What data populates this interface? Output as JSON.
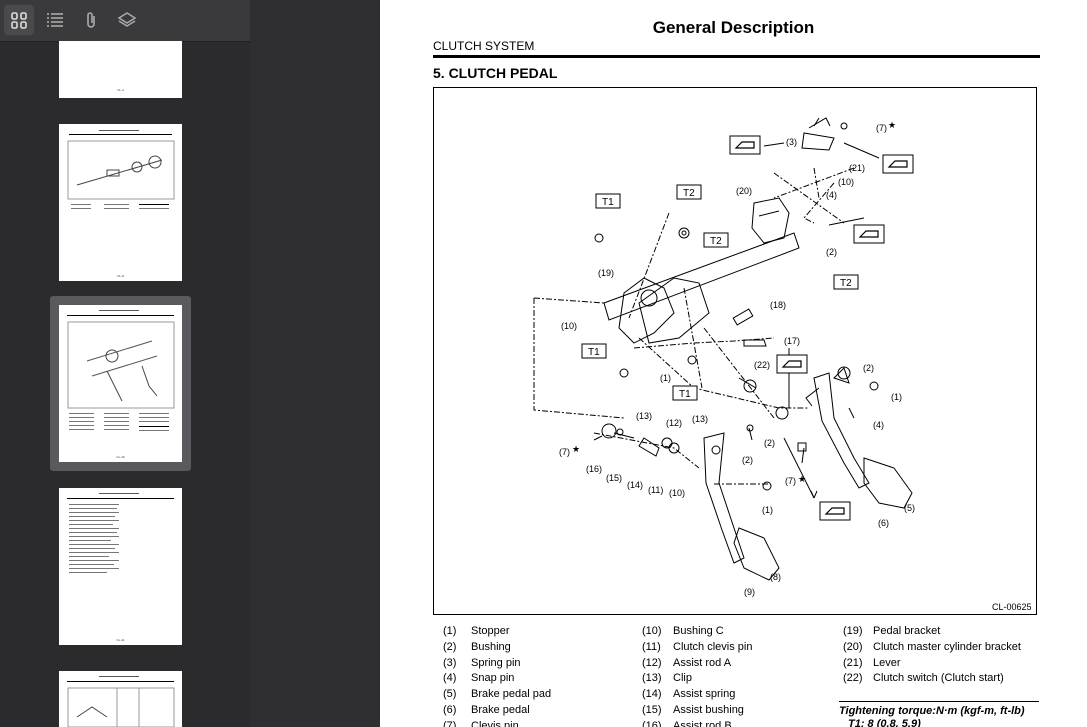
{
  "sidebar": {
    "toolbar": [
      {
        "name": "thumbnails-view",
        "icon": "grid-icon"
      },
      {
        "name": "outline-view",
        "icon": "list-icon"
      },
      {
        "name": "attachments-view",
        "icon": "paperclip-icon"
      },
      {
        "name": "layers-view",
        "icon": "layers-icon"
      }
    ],
    "thumbnails": [
      {
        "page_label": "CL-4"
      },
      {
        "page_label": "CL-8"
      },
      {
        "page_label": "CL-10"
      },
      {
        "page_label": "CL-11"
      },
      {
        "page_label": ""
      }
    ]
  },
  "document": {
    "title": "General Description",
    "section": "CLUTCH SYSTEM",
    "heading": "5.  CLUTCH PEDAL",
    "figure_code": "CL-00625",
    "labels": {
      "T1": "T1",
      "T2": "T2",
      "n1": "(1)",
      "n2": "(2)",
      "n3": "(3)",
      "n4": "(4)",
      "n6": "(6)",
      "n5": "(5)",
      "n7": "(7)",
      "n8": "(8)",
      "n9": "(9)",
      "n10": "(10)",
      "n11": "(11)",
      "n12": "(12)",
      "n13": "(13)",
      "n14": "(14)",
      "n15": "(15)",
      "n16": "(16)",
      "n17": "(17)",
      "n18": "(18)",
      "n19": "(19)",
      "n20": "(20)",
      "n21": "(21)",
      "n22": "(22)",
      "star": "★"
    },
    "legend": [
      [
        {
          "num": "(1)",
          "text": "Stopper"
        },
        {
          "num": "(2)",
          "text": "Bushing"
        },
        {
          "num": "(3)",
          "text": "Spring pin"
        },
        {
          "num": "(4)",
          "text": "Snap pin"
        },
        {
          "num": "(5)",
          "text": "Brake pedal pad"
        },
        {
          "num": "(6)",
          "text": "Brake pedal"
        },
        {
          "num": "(7)",
          "text": "Clevis pin"
        }
      ],
      [
        {
          "num": "(10)",
          "text": "Bushing C"
        },
        {
          "num": "(11)",
          "text": "Clutch clevis pin"
        },
        {
          "num": "(12)",
          "text": "Assist rod A"
        },
        {
          "num": "(13)",
          "text": "Clip"
        },
        {
          "num": "(14)",
          "text": "Assist spring"
        },
        {
          "num": "(15)",
          "text": "Assist bushing"
        },
        {
          "num": "(16)",
          "text": "Assist rod B"
        }
      ],
      [
        {
          "num": "(19)",
          "text": "Pedal bracket"
        },
        {
          "num": "(20)",
          "text": "Clutch master cylinder bracket"
        },
        {
          "num": "(21)",
          "text": "Lever"
        },
        {
          "num": "(22)",
          "text": "Clutch switch (Clutch start)"
        }
      ]
    ],
    "torque_title": "Tightening torque:N·m (kgf-m, ft-lb)",
    "torque_t1": "T1:   8 (0.8, 5.9)"
  }
}
